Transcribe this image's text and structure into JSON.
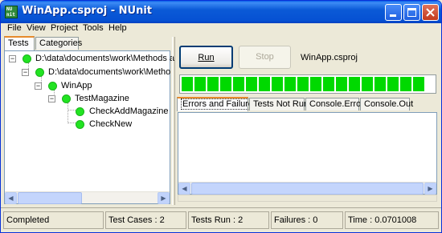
{
  "window": {
    "title": "WinApp.csproj - NUnit",
    "icon_text": "NU nit",
    "controls": {
      "minimize": "minimize-icon",
      "maximize": "maximize-icon",
      "close": "close-icon"
    }
  },
  "menubar": {
    "items": [
      {
        "label": "File",
        "mnemonic": "F"
      },
      {
        "label": "View",
        "mnemonic": "V"
      },
      {
        "label": "Project",
        "mnemonic": "P"
      },
      {
        "label": "Tools",
        "mnemonic": "T"
      },
      {
        "label": "Help",
        "mnemonic": "H"
      }
    ]
  },
  "left_tabs": {
    "tests": "Tests",
    "categories": "Categories"
  },
  "tree": {
    "nodes": [
      {
        "label": "D:\\data\\documents\\work\\Methods a",
        "status": "passed",
        "expanded": true
      },
      {
        "label": "D:\\data\\documents\\work\\Metho",
        "status": "passed",
        "expanded": true
      },
      {
        "label": "WinApp",
        "status": "passed",
        "expanded": true
      },
      {
        "label": "TestMagazine",
        "status": "passed",
        "expanded": true
      },
      {
        "label": "CheckAddMagazine",
        "status": "passed"
      },
      {
        "label": "CheckNew",
        "status": "passed"
      }
    ]
  },
  "controls": {
    "run_label": "Run",
    "stop_label": "Stop",
    "project_name": "WinApp.csproj"
  },
  "progress": {
    "fraction": 1.0,
    "color": "#00d900"
  },
  "result_tabs": [
    {
      "label": "Errors and Failures",
      "active": true
    },
    {
      "label": "Tests Not Run",
      "active": false
    },
    {
      "label": "Console.Error",
      "active": false
    },
    {
      "label": "Console.Out",
      "active": false
    }
  ],
  "status": {
    "state": "Completed",
    "test_cases": "Test Cases : 2",
    "tests_run": "Tests Run : 2",
    "failures": "Failures : 0",
    "time": "Time : 0.0701008"
  },
  "colors": {
    "titlebar": "#0b5ad7",
    "pass_green": "#22e322",
    "tab_highlight": "#e68b2c"
  }
}
